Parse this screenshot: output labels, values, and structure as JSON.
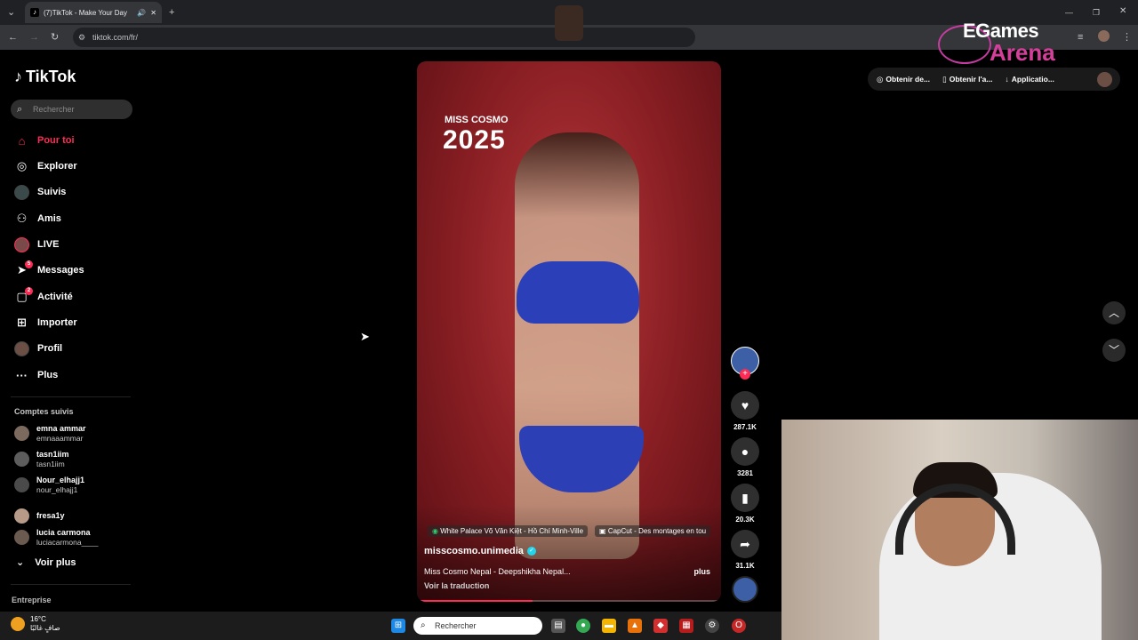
{
  "browser": {
    "tab_title": "(7)TikTok - Make Your Day",
    "url": "tiktok.com/fr/",
    "new_tab": "+",
    "close_tab": "✕"
  },
  "tiktok": {
    "logo": "TikTok",
    "search_placeholder": "Rechercher",
    "nav": [
      {
        "label": "Pour toi",
        "icon": "home-icon",
        "active": true
      },
      {
        "label": "Explorer",
        "icon": "compass-icon"
      },
      {
        "label": "Suivis",
        "icon": "following-avatar-icon"
      },
      {
        "label": "Amis",
        "icon": "friends-icon"
      },
      {
        "label": "LIVE",
        "icon": "live-avatar-icon"
      },
      {
        "label": "Messages",
        "icon": "messages-icon",
        "badge": "5"
      },
      {
        "label": "Activité",
        "icon": "activity-icon",
        "badge": "2"
      },
      {
        "label": "Importer",
        "icon": "upload-icon"
      },
      {
        "label": "Profil",
        "icon": "profile-avatar-icon"
      },
      {
        "label": "Plus",
        "icon": "more-icon"
      }
    ],
    "comptes_suivis_title": "Comptes suivis",
    "accounts": [
      {
        "name": "emna ammar",
        "user": "emnaaammar"
      },
      {
        "name": "tasn1iim",
        "user": "tasn1iim"
      },
      {
        "name": "Nour_elhajj1",
        "user": "nour_elhajj1"
      },
      {
        "name": "fresa1y",
        "user": ""
      },
      {
        "name": "lucia carmona",
        "user": "luciacarmona____"
      }
    ],
    "voir_plus": "Voir plus",
    "entreprise": "Entreprise"
  },
  "video": {
    "overlay_title": "MISS COSMO",
    "overlay_year": "2025",
    "tag_location": "White Palace Võ Văn Kiệt - Hồ Chí Minh-Ville",
    "tag_capcut": "CapCut - Des montages en tou",
    "username": "misscosmo.unimedia",
    "description": "Miss Cosmo Nepal - Deepshikha Nepal...",
    "more": "plus",
    "translate": "Voir la traduction",
    "progress": 0.38
  },
  "actions": {
    "likes": "287.1K",
    "comments": "3281",
    "saves": "20.3K",
    "shares": "31.1K"
  },
  "top_buttons": {
    "b1": "Obtenir de...",
    "b2": "Obtenir l'a...",
    "b3": "Applicatio..."
  },
  "overlay": {
    "brand_line1": "EGames",
    "brand_line2": "Arena"
  },
  "taskbar": {
    "temp": "16°C",
    "weather_text": "صافٍ غالبًا",
    "search": "Rechercher"
  },
  "colors": {
    "accent": "#fe2c55",
    "browser_bg": "#202124"
  }
}
